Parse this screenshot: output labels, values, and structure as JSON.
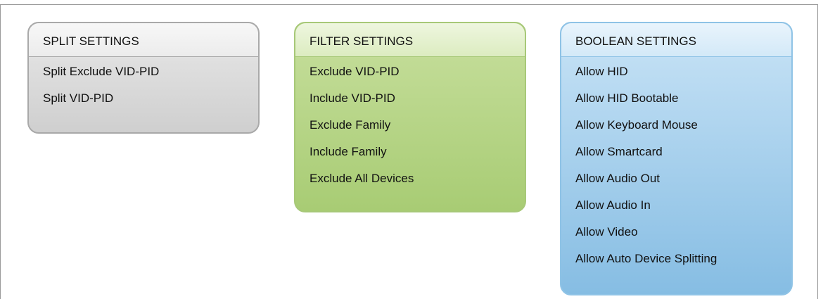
{
  "panels": {
    "split": {
      "title": "SPLIT SETTINGS",
      "items": [
        "Split Exclude VID-PID",
        "Split VID-PID"
      ]
    },
    "filter": {
      "title": "FILTER SETTINGS",
      "items": [
        "Exclude VID-PID",
        "Include VID-PID",
        "Exclude Family",
        "Include Family",
        "Exclude All Devices"
      ]
    },
    "boolean": {
      "title": "BOOLEAN SETTINGS",
      "items": [
        "Allow HID",
        "Allow HID Bootable",
        "Allow Keyboard Mouse",
        "Allow Smartcard",
        "Allow Audio Out",
        "Allow Audio In",
        "Allow Video",
        "Allow Auto Device Splitting"
      ]
    }
  },
  "colors": {
    "split_accent": "#cfcfcf",
    "filter_accent": "#a8cc74",
    "boolean_accent": "#86bde3"
  }
}
